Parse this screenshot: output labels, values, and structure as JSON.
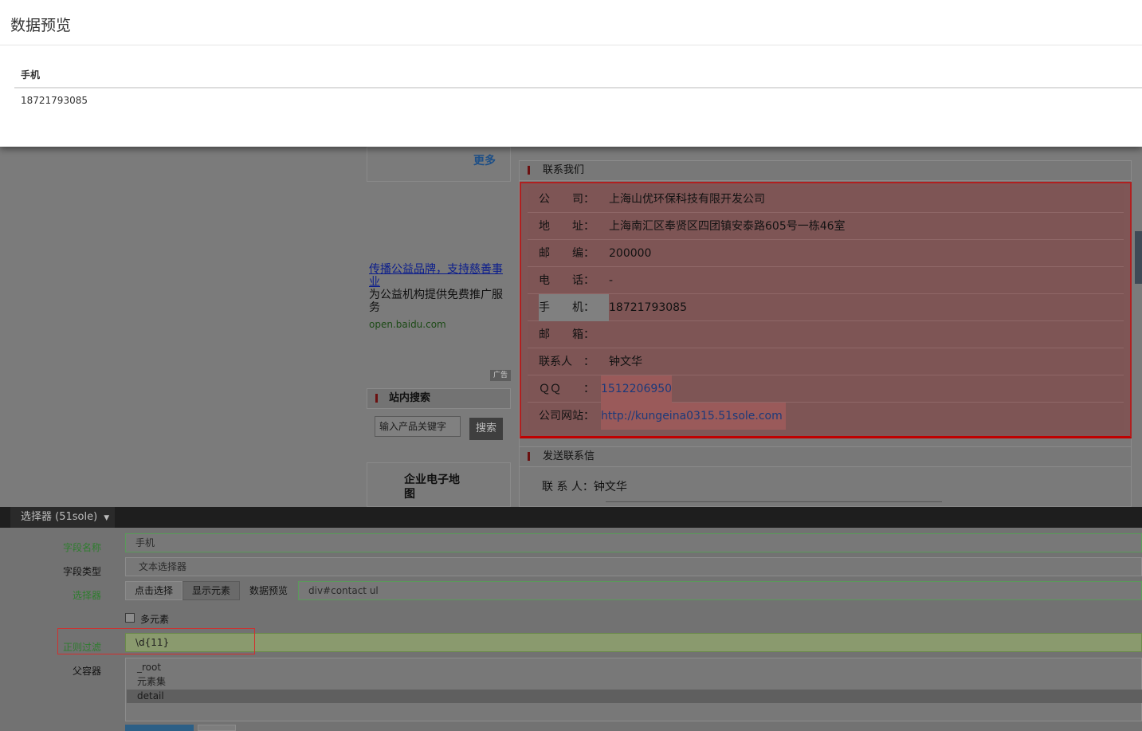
{
  "preview": {
    "title": "数据预览",
    "column": "手机",
    "value": "18721793085"
  },
  "page": {
    "more_label": "更多",
    "ad": {
      "title": "传播公益品牌，支持慈善事业",
      "desc": "为公益机构提供免费推广服务",
      "url": "open.baidu.com",
      "badge": "广告"
    },
    "site_search": {
      "title": "站内搜索",
      "placeholder": "输入产品关键字",
      "button": "搜索"
    },
    "emap": "企业电子地图",
    "contact": {
      "title": "联系我们",
      "rows": [
        {
          "label": "公　　司：",
          "value": "上海山优环保科技有限开发公司"
        },
        {
          "label": "地　　址：",
          "value": "上海南汇区奉贤区四团镇安泰路605号一栋46室"
        },
        {
          "label": "邮　　编：",
          "value": "200000"
        },
        {
          "label": "电　　话：",
          "value": "-"
        },
        {
          "label": "手　　机：",
          "value": "18721793085"
        },
        {
          "label": "邮　　箱：",
          "value": ""
        },
        {
          "label": "联系人　：",
          "value": "钟文华"
        },
        {
          "label": "ＱＱ　　：",
          "value": "1512206950"
        },
        {
          "label": "公司网站：",
          "value": "http://kungeina0315.51sole.com"
        }
      ]
    },
    "send_msg": {
      "title": "发送联系信",
      "contact_label": "联 系 人：",
      "contact_value": "钟文华"
    }
  },
  "editor": {
    "tab": "选择器 (51sole)",
    "field_name": {
      "label": "字段名称",
      "value": "手机"
    },
    "field_type": {
      "label": "字段类型",
      "value": "文本选择器"
    },
    "selector": {
      "label": "选择器",
      "btn_click": "点击选择",
      "btn_show": "显示元素",
      "btn_preview": "数据预览",
      "value": "div#contact ul"
    },
    "multi": "多元素",
    "regex": {
      "label": "正则过滤",
      "value": "\\d{11}"
    },
    "parent": {
      "label": "父容器",
      "options": [
        "_root",
        "元素集",
        "detail"
      ],
      "selected": "detail"
    },
    "colors": {
      "green_label": "#2e7d2e",
      "highlight_border": "#d0302e"
    }
  }
}
